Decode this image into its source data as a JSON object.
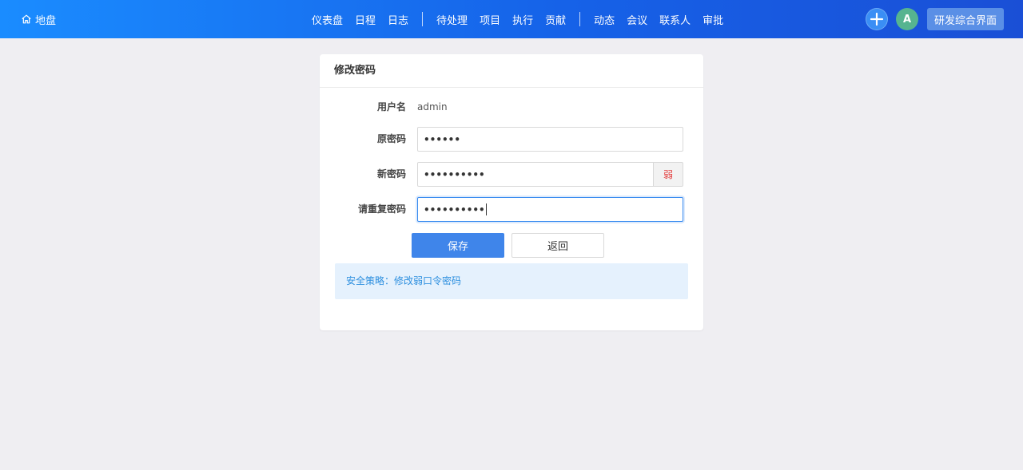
{
  "header": {
    "brand_icon": "home-icon",
    "brand_label": "地盘",
    "nav_groups": [
      [
        "仪表盘",
        "日程",
        "日志"
      ],
      [
        "待处理",
        "项目",
        "执行",
        "贡献"
      ],
      [
        "动态",
        "会议",
        "联系人",
        "审批"
      ]
    ],
    "add_icon": "plus-icon",
    "avatar_letter": "A",
    "workspace_label": "研发综合界面"
  },
  "card": {
    "title": "修改密码",
    "username_label": "用户名",
    "username_value": "admin",
    "old_password_label": "原密码",
    "old_password_value": "••••••",
    "new_password_label": "新密码",
    "new_password_value": "••••••••••",
    "strength_label": "弱",
    "repeat_password_label": "请重复密码",
    "repeat_password_value": "••••••••••",
    "save_label": "保存",
    "back_label": "返回",
    "notice": "安全策略：修改弱口令密码"
  },
  "colors": {
    "header_gradient_start": "#1a8cff",
    "header_gradient_end": "#1a4fd6",
    "primary": "#3f85ea",
    "weak": "#e33a3a",
    "notice_bg": "#e5f1fd",
    "notice_text": "#2d8fdf"
  }
}
